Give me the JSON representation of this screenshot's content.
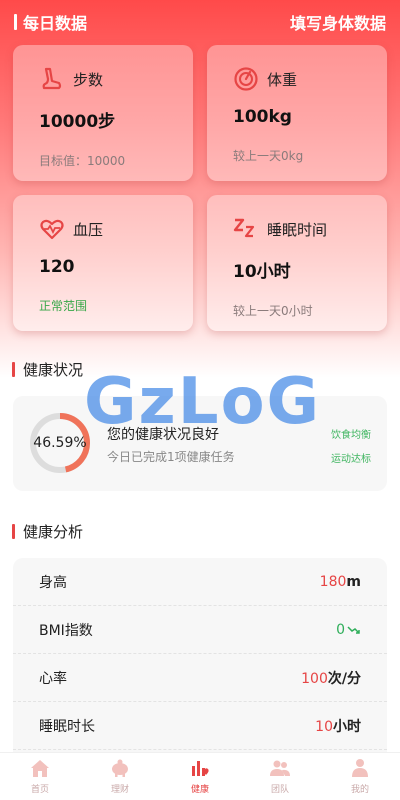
{
  "header": {
    "title": "每日数据",
    "action": "填写身体数据"
  },
  "cards": [
    {
      "name": "steps",
      "icon": "foot-icon",
      "label": "步数",
      "value": "10000步",
      "sub": "目标值：10000"
    },
    {
      "name": "weight",
      "icon": "gauge-icon",
      "label": "体重",
      "value": "100kg",
      "sub": "较上一天0kg"
    },
    {
      "name": "blood-pressure",
      "icon": "heart-pulse-icon",
      "label": "血压",
      "value": "120",
      "sub": "正常范围"
    },
    {
      "name": "sleep",
      "icon": "zzz-icon",
      "label": "睡眠时间",
      "value": "10小时",
      "sub": "较上一天0小时"
    }
  ],
  "health": {
    "section_title": "健康状况",
    "percent_label": "46.59%",
    "percent": 0.4659,
    "main": "您的健康状况良好",
    "sub": "今日已完成1项健康任务",
    "tags": [
      "饮食均衡",
      "运动达标"
    ]
  },
  "watermark": "GzLoG",
  "analysis": {
    "section_title": "健康分析",
    "rows": [
      {
        "label": "身高",
        "value": "180",
        "unit": "m"
      },
      {
        "label": "BMI指数",
        "value": "0",
        "unit": ""
      },
      {
        "label": "心率",
        "value": "100",
        "unit": "次/分"
      },
      {
        "label": "睡眠时长",
        "value": "10",
        "unit": "小时"
      }
    ]
  },
  "tabs": [
    {
      "label": "首页",
      "icon": "home-icon"
    },
    {
      "label": "理财",
      "icon": "piggy-bank-icon"
    },
    {
      "label": "健康",
      "icon": "health-chart-icon",
      "active": true
    },
    {
      "label": "团队",
      "icon": "team-icon"
    },
    {
      "label": "我的",
      "icon": "user-icon"
    }
  ],
  "colors": {
    "accent": "#e64545",
    "green": "#39a84a",
    "ring_bg": "#dddddd"
  }
}
